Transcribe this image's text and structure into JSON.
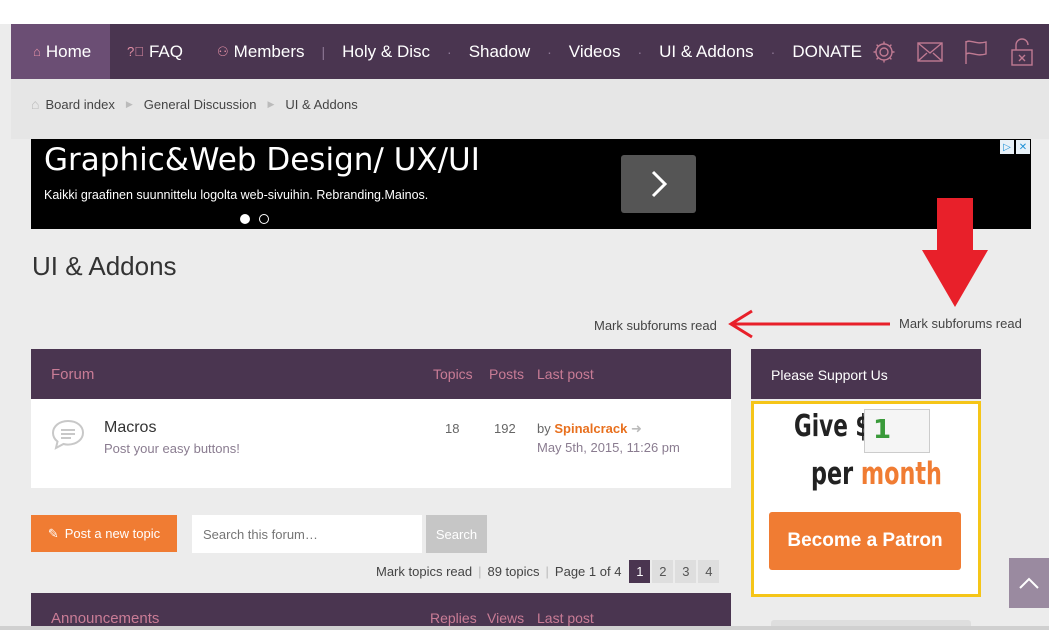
{
  "nav": {
    "items": [
      {
        "label": "Home",
        "icon": "home-icon"
      },
      {
        "label": "FAQ",
        "icon": "question-icon"
      },
      {
        "label": "Members",
        "icon": "members-icon"
      },
      {
        "label": "Holy & Disc"
      },
      {
        "label": "Shadow"
      },
      {
        "label": "Videos"
      },
      {
        "label": "UI & Addons"
      },
      {
        "label": "DONATE"
      }
    ],
    "right_icons": [
      "gear-icon",
      "mail-icon",
      "flag-icon",
      "lock-icon"
    ]
  },
  "breadcrumb": [
    "Board index",
    "General Discussion",
    "UI & Addons"
  ],
  "ad": {
    "title": "Graphic&Web Design/ UX/UI",
    "description": "Kaikki graafinen suunnittelu logolta web-sivuihin. Rebranding.Mainos."
  },
  "page": {
    "title": "UI & Addons",
    "mark_subforums": "Mark subforums read",
    "mark_subforums_annotated": "Mark subforums read"
  },
  "forum_table": {
    "headers": {
      "forum": "Forum",
      "topics": "Topics",
      "posts": "Posts",
      "last_post": "Last post"
    },
    "rows": [
      {
        "title": "Macros",
        "description": "Post your easy buttons!",
        "topics": "18",
        "posts": "192",
        "by": "by",
        "author": "Spinalcrack",
        "date": "May 5th, 2015, 11:26 pm"
      }
    ]
  },
  "actions": {
    "post_new_topic": "Post a new topic",
    "search_placeholder": "Search this forum…",
    "search_button": "Search"
  },
  "pagination": {
    "mark_topics": "Mark topics read",
    "count": "89 topics",
    "page_label": "Page 1 of 4",
    "pages": [
      "1",
      "2",
      "3",
      "4"
    ],
    "current": "1"
  },
  "announcements": {
    "title": "Announcements",
    "replies": "Replies",
    "views": "Views",
    "last_post": "Last post"
  },
  "sidebar": {
    "support_title": "Please Support Us",
    "give": "Give $",
    "amount": "1",
    "per": "per",
    "month": "month",
    "patron_button": "Become a Patron"
  },
  "colors": {
    "nav_bg": "#4a3550",
    "nav_active": "#6b4e74",
    "accent_orange": "#f07c33",
    "header_text": "#c97c96",
    "annotation_red": "#e8202a",
    "patron_border": "#f5c518"
  }
}
